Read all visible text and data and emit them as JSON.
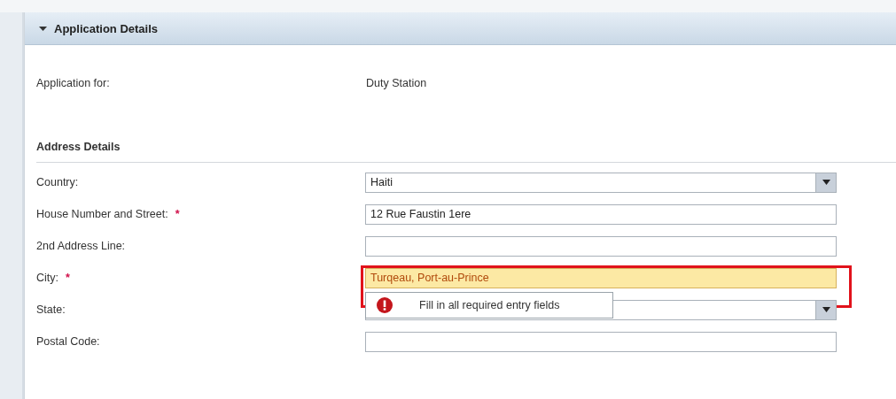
{
  "panel": {
    "title": "Application Details",
    "expanded": true
  },
  "info_rows": [
    {
      "label": "Application for:",
      "value": "Duty Station"
    }
  ],
  "section": {
    "title": "Address Details"
  },
  "required_mark": "*",
  "fields": [
    {
      "kind": "dropdown",
      "label": "Country:",
      "value": "Haiti",
      "required": false,
      "error": false
    },
    {
      "kind": "text",
      "label": "House Number and Street:",
      "value": "12 Rue Faustin 1ere",
      "required": true,
      "error": false
    },
    {
      "kind": "text",
      "label": "2nd Address Line:",
      "required": false,
      "error": false
    },
    {
      "kind": "text",
      "label": "City:",
      "value": "Turqeau, Port-au-Prince",
      "required": true,
      "error": true,
      "tooltip": "Fill in all required entry fields"
    },
    {
      "kind": "dropdown",
      "label": "State:",
      "required": false,
      "error": false
    },
    {
      "kind": "text",
      "label": "Postal Code:",
      "required": false,
      "error": false
    }
  ]
}
